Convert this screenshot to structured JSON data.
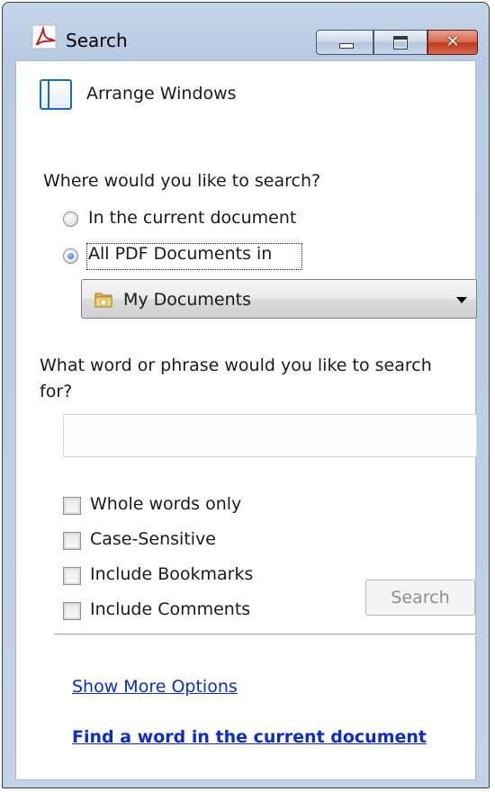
{
  "window": {
    "title": "Search"
  },
  "arrange": {
    "label": "Arrange Windows"
  },
  "location": {
    "prompt": "Where would you like to search?",
    "options": [
      {
        "label": "In the current document",
        "selected": false
      },
      {
        "label": "All PDF Documents in",
        "selected": true
      }
    ],
    "folder_selected": "My Documents"
  },
  "query": {
    "prompt": "What word or phrase would you like to search for?",
    "value": "",
    "placeholder": ""
  },
  "options": {
    "checkboxes": [
      {
        "label": "Whole words only",
        "checked": false
      },
      {
        "label": "Case-Sensitive",
        "checked": false
      },
      {
        "label": "Include Bookmarks",
        "checked": false
      },
      {
        "label": "Include Comments",
        "checked": false
      }
    ],
    "search_button": "Search"
  },
  "links": {
    "more_options": "Show More Options",
    "find_word": "Find a word in the current document"
  },
  "icons": {
    "app": "acrobat-icon",
    "arrange": "arrange-windows-icon",
    "folder": "folder-icon",
    "dropdown": "chevron-down-icon"
  },
  "colors": {
    "link": "#0a2bd6",
    "title_bar": "#b7cbe2",
    "close_button": "#c0391b"
  }
}
